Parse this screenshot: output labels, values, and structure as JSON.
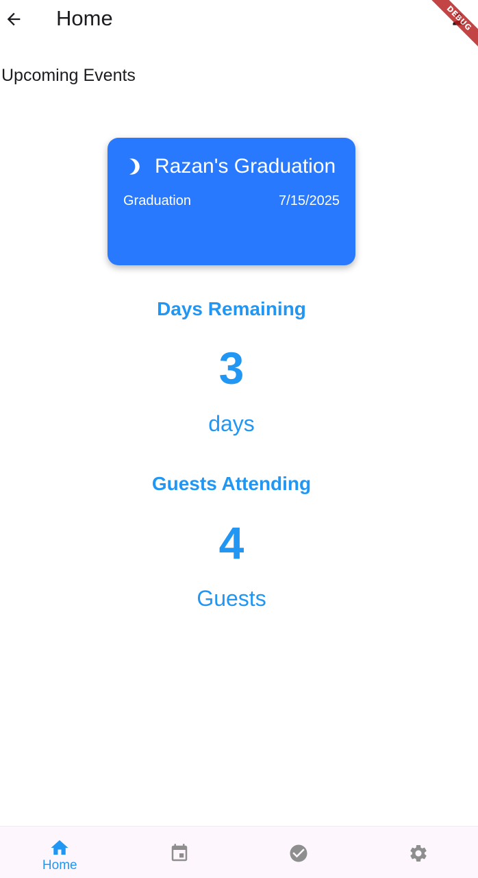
{
  "app_bar": {
    "title": "Home",
    "back_icon": "arrow-back-icon",
    "profile_icon": "person-icon"
  },
  "debug_banner": {
    "label": "DEBUG"
  },
  "section": {
    "title": "Upcoming Events"
  },
  "event_card": {
    "icon": "moon-icon",
    "title": "Razan's Graduation",
    "type": "Graduation",
    "date": "7/15/2025",
    "color": "#2979ff"
  },
  "days_remaining": {
    "label": "Days Remaining",
    "value": "3",
    "unit": "days"
  },
  "guests": {
    "label": "Guests Attending",
    "value": "4",
    "unit": "Guests"
  },
  "bottom_nav": {
    "items": [
      {
        "label": "Home",
        "icon": "home-icon",
        "active": true
      },
      {
        "label": "",
        "icon": "calendar-icon",
        "active": false
      },
      {
        "label": "",
        "icon": "check-circle-icon",
        "active": false
      },
      {
        "label": "",
        "icon": "gear-icon",
        "active": false
      }
    ]
  },
  "colors": {
    "accent": "#2196f3",
    "card": "#2979ff",
    "inactive_icon": "#8e8e8e",
    "nav_background": "#fdf7fd"
  }
}
